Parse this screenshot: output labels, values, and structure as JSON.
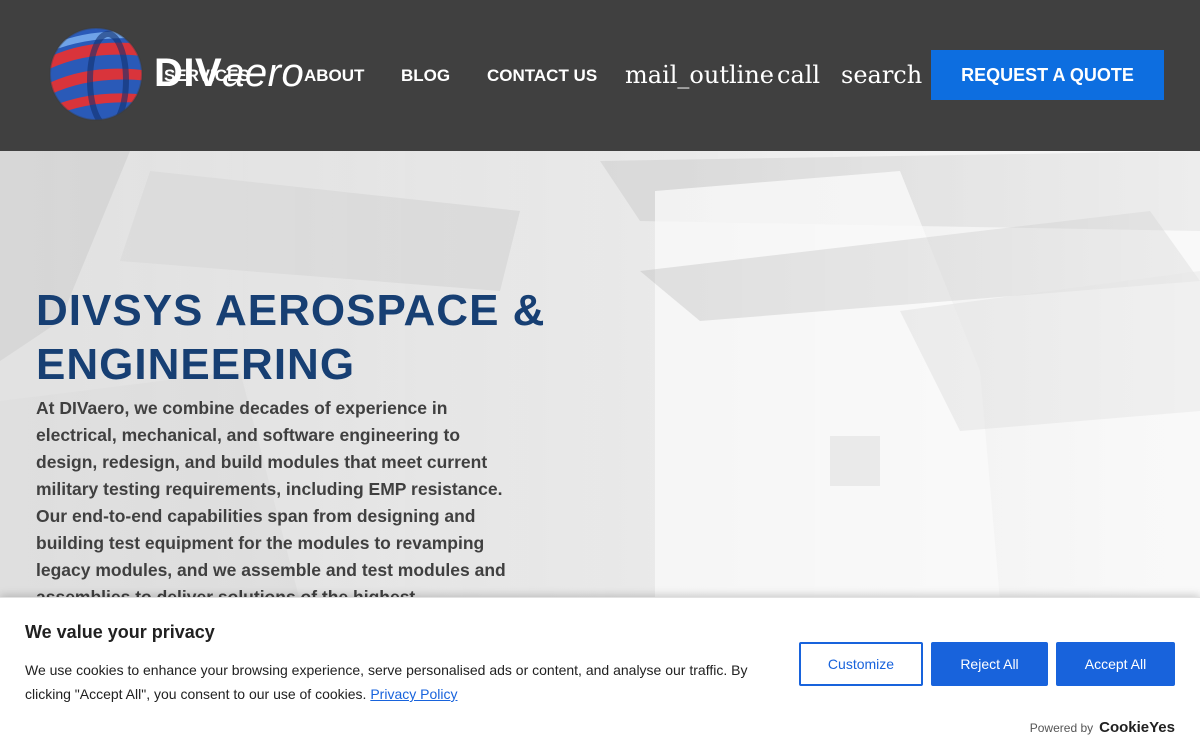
{
  "header": {
    "logo_text_bold": "DIV",
    "logo_text_light": "aero",
    "nav": [
      {
        "label": "SERVICES"
      },
      {
        "label": "ABOUT"
      },
      {
        "label": "BLOG"
      },
      {
        "label": "CONTACT US"
      }
    ],
    "icons": {
      "mail": "mail_outline",
      "call": "call",
      "search": "search"
    },
    "cta_label": "REQUEST A QUOTE"
  },
  "hero": {
    "title_line1": "DIVSYS AEROSPACE &",
    "title_line2": "ENGINEERING",
    "body": "At DIVaero, we combine decades of experience in electrical, mechanical, and software engineering to design, redesign, and build modules that meet current military testing requirements, including EMP resistance. Our end-to-end capabilities span from designing and building test equipment for the modules to revamping legacy modules, and we assemble and test modules and assemblies to deliver solutions of the highest"
  },
  "cookie_banner": {
    "title": "We value your privacy",
    "text": "We use cookies to enhance your browsing experience, serve personalised ads or content, and analyse our traffic. By clicking \"Accept All\", you consent to our use of cookies.",
    "policy_link": "Privacy Policy",
    "customize_label": "Customize",
    "reject_label": "Reject All",
    "accept_label": "Accept All",
    "powered_by": "Powered by",
    "powered_brand": "CookieYes"
  },
  "colors": {
    "header_bg": "#404040",
    "cta": "#0d6ee0",
    "title": "#173f73",
    "cookie_accent": "#1863dc"
  }
}
